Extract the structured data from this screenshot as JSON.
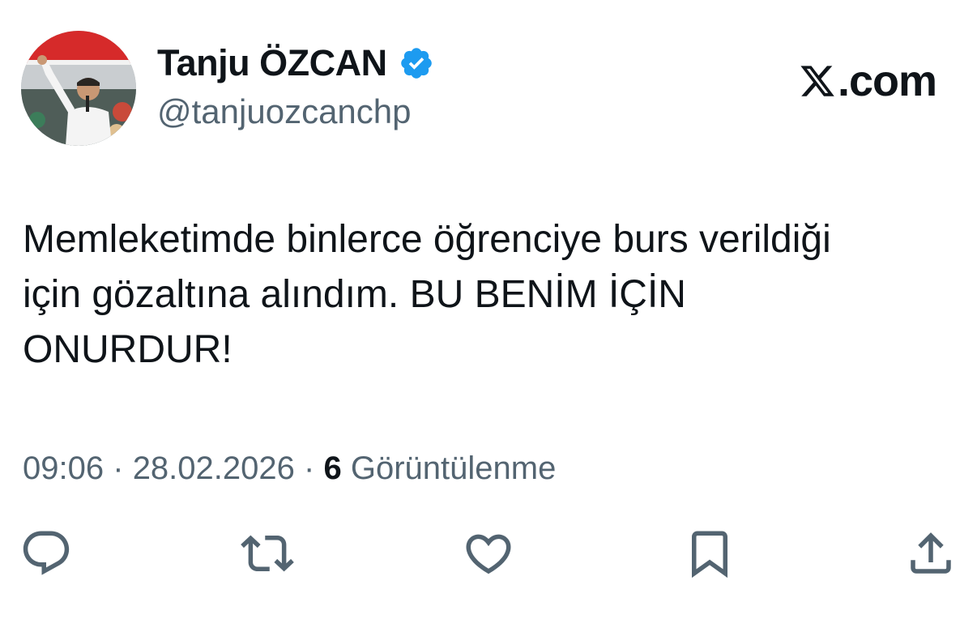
{
  "author": {
    "display_name": "Tanju ÖZCAN",
    "handle": "@tanjuozcanchp",
    "verified": true,
    "verified_color": "#1d9bf0"
  },
  "brand": {
    "label": ".com",
    "icon": "x-logo-icon"
  },
  "tweet": {
    "text": "Memleketimde binlerce öğrenciye burs verildiği\niçin gözaltına alındım. BU BENİM İÇİN\nONURDUR!",
    "time": "09:06",
    "separator": "·",
    "date": "28.02.2026",
    "views_count": "6",
    "views_label": "Görüntülenme"
  },
  "actions": [
    {
      "name": "reply",
      "icon": "reply-icon"
    },
    {
      "name": "retweet",
      "icon": "retweet-icon"
    },
    {
      "name": "like",
      "icon": "heart-icon"
    },
    {
      "name": "bookmark",
      "icon": "bookmark-icon"
    },
    {
      "name": "share",
      "icon": "share-icon"
    }
  ],
  "colors": {
    "text": "#0f1419",
    "secondary": "#536471"
  }
}
